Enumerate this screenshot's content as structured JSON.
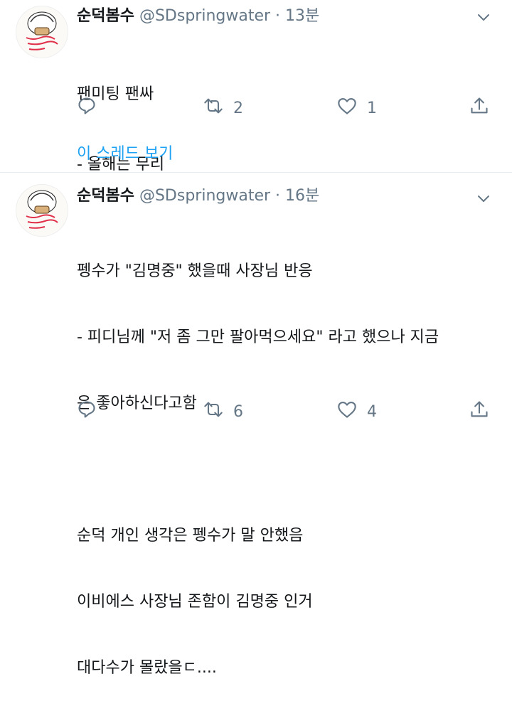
{
  "tweets": [
    {
      "name": "순덕봄수",
      "handle": "@SDspringwater",
      "dot": "·",
      "time": "13분",
      "lines": [
        "팬미팅 팬싸",
        "- 올해는 무리"
      ],
      "retweets": "2",
      "likes": "1",
      "thread_link": "이 스레드 보기"
    },
    {
      "name": "순덕봄수",
      "handle": "@SDspringwater",
      "dot": "·",
      "time": "16분",
      "lines": [
        "펭수가 \"김명중\" 했을때 사장님 반응",
        "- 피디님께 \"저 좀 그만 팔아먹으세요\" 라고 했으나 지금",
        "은 좋아하신다고함",
        "",
        "순덕 개인 생각은 펭수가 말 안했음",
        "이비에스 사장님 존함이 김명중 인거",
        "대다수가 몰랐을ㄷ...."
      ],
      "retweets": "6",
      "likes": "4"
    }
  ],
  "icons": {
    "reply": "reply-icon",
    "retweet": "retweet-icon",
    "like": "heart-icon",
    "share": "share-icon",
    "caret": "chevron-down-icon"
  },
  "colors": {
    "link": "#1da1f2",
    "secondary": "#657786",
    "text": "#14171a",
    "divider": "#e6ecf0"
  }
}
